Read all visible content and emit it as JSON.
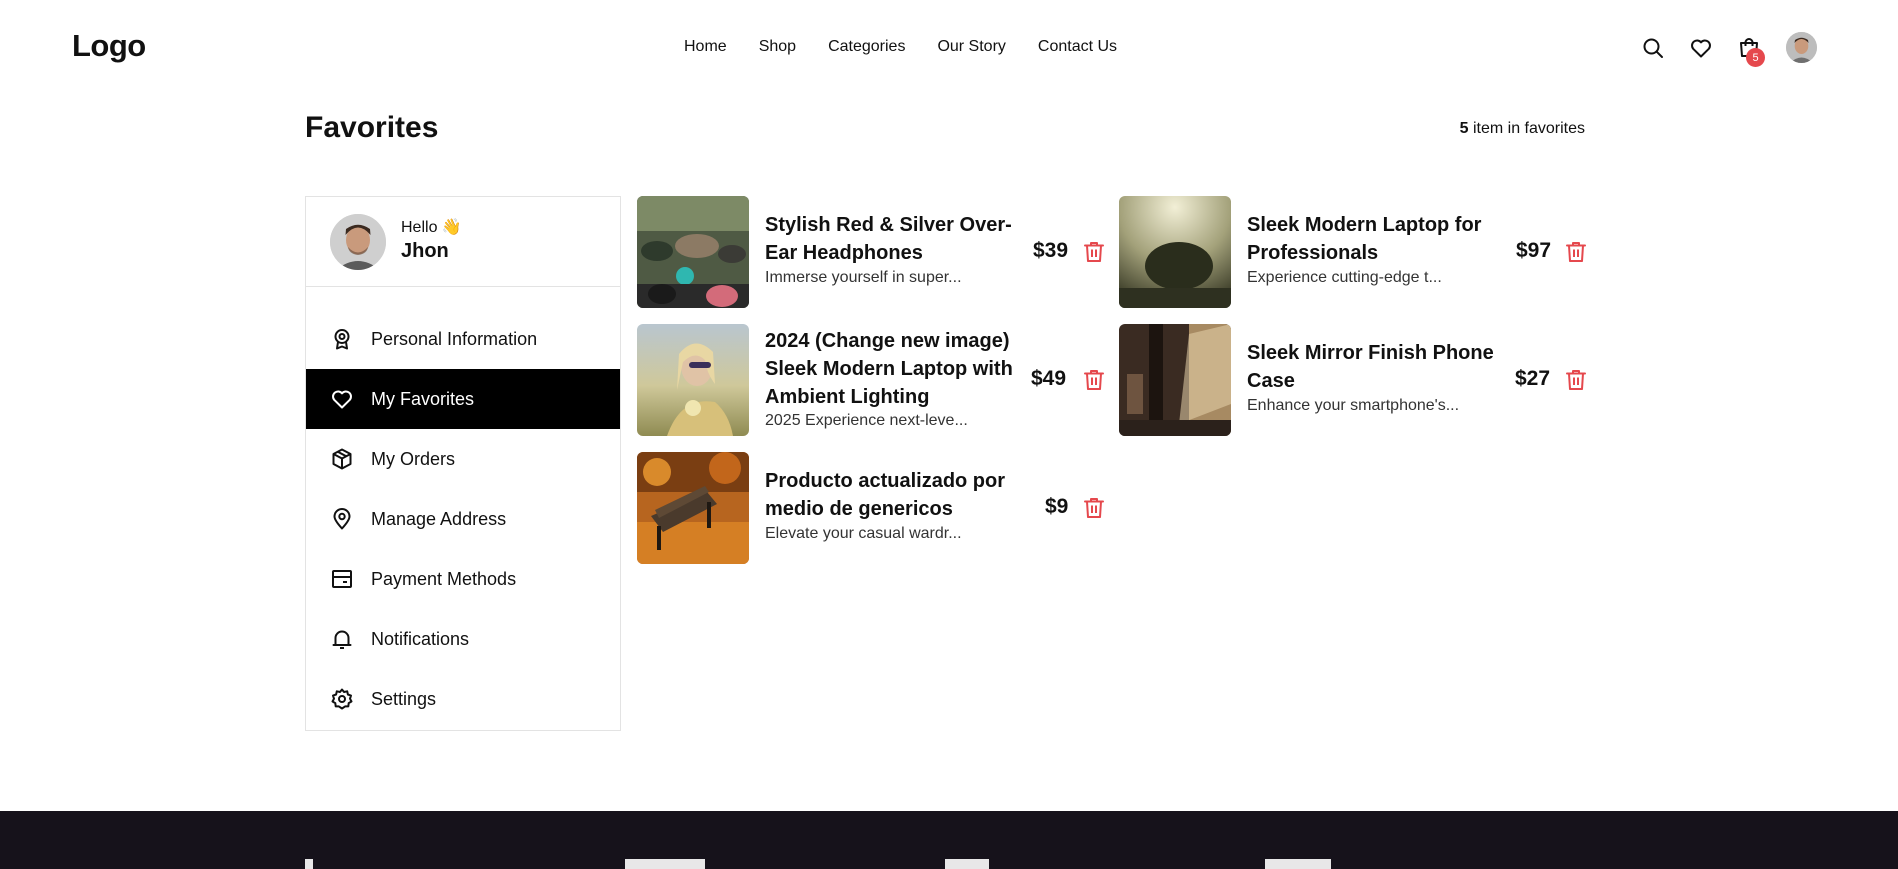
{
  "header": {
    "logo": "Logo",
    "nav": [
      "Home",
      "Shop",
      "Categories",
      "Our Story",
      "Contact Us"
    ],
    "cart_count": "5",
    "icons": [
      "search-icon",
      "heart-icon",
      "cart-icon",
      "user-avatar"
    ]
  },
  "page": {
    "title": "Favorites",
    "count_number": "5",
    "count_suffix": " item in favorites"
  },
  "sidebar": {
    "hello": "Hello 👋",
    "user_name": "Jhon",
    "items": [
      {
        "label": "Personal Information",
        "icon": "badge-icon",
        "active": false
      },
      {
        "label": "My Favorites",
        "icon": "heart-icon",
        "active": true
      },
      {
        "label": "My Orders",
        "icon": "box-icon",
        "active": false
      },
      {
        "label": "Manage Address",
        "icon": "location-pin-icon",
        "active": false
      },
      {
        "label": "Payment Methods",
        "icon": "card-icon",
        "active": false
      },
      {
        "label": "Notifications",
        "icon": "bell-icon",
        "active": false
      },
      {
        "label": "Settings",
        "icon": "gear-icon",
        "active": false
      }
    ]
  },
  "favorites": [
    {
      "title": "Stylish Red & Silver Over-Ear Headphones",
      "desc": "Immerse yourself in super...",
      "price": "$39"
    },
    {
      "title": "Sleek Modern Laptop for Professionals",
      "desc": "Experience cutting-edge t...",
      "price": "$97"
    },
    {
      "title": "2024 (Change new image) Sleek Modern Laptop with Ambient Lighting",
      "desc": "2025 Experience next-leve...",
      "price": "$49"
    },
    {
      "title": "Sleek Mirror Finish Phone Case",
      "desc": "Enhance your smartphone's...",
      "price": "$27"
    },
    {
      "title": "Producto actualizado por medio de genericos",
      "desc": "Elevate your casual wardr...",
      "price": "$9"
    }
  ],
  "colors": {
    "accent_delete": "#e5484d",
    "active_menu_bg": "#000000",
    "footer_bg": "#16121b"
  }
}
